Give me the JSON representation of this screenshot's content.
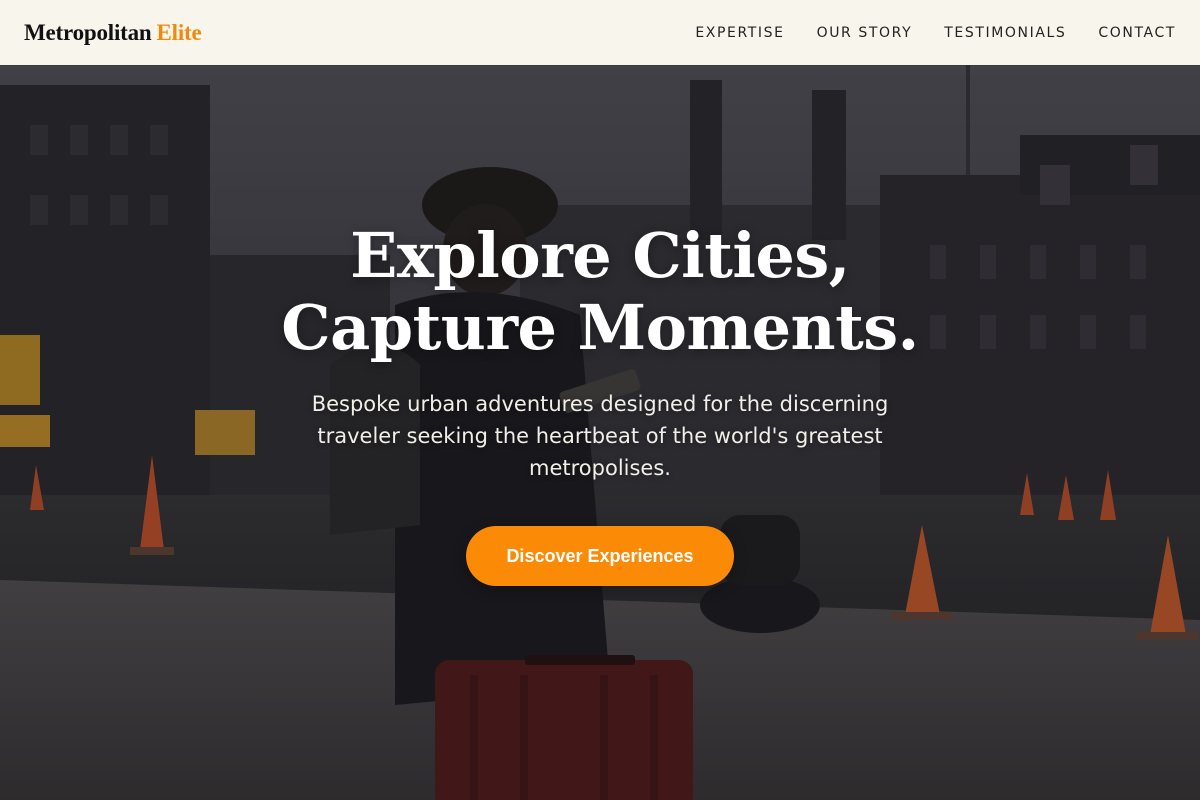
{
  "brand": {
    "name": "Metropolitan",
    "accent": "Elite",
    "accent_color": "#f08a0c"
  },
  "nav": {
    "items": [
      {
        "label": "EXPERTISE"
      },
      {
        "label": "OUR STORY"
      },
      {
        "label": "TESTIMONIALS"
      },
      {
        "label": "CONTACT"
      }
    ]
  },
  "hero": {
    "title_line1": "Explore Cities,",
    "title_line2": "Capture Moments.",
    "subtitle": "Bespoke urban adventures designed for the discerning traveler seeking the heartbeat of the world's greatest metropolises.",
    "cta_label": "Discover Experiences",
    "cta_color": "#fb8a06"
  }
}
